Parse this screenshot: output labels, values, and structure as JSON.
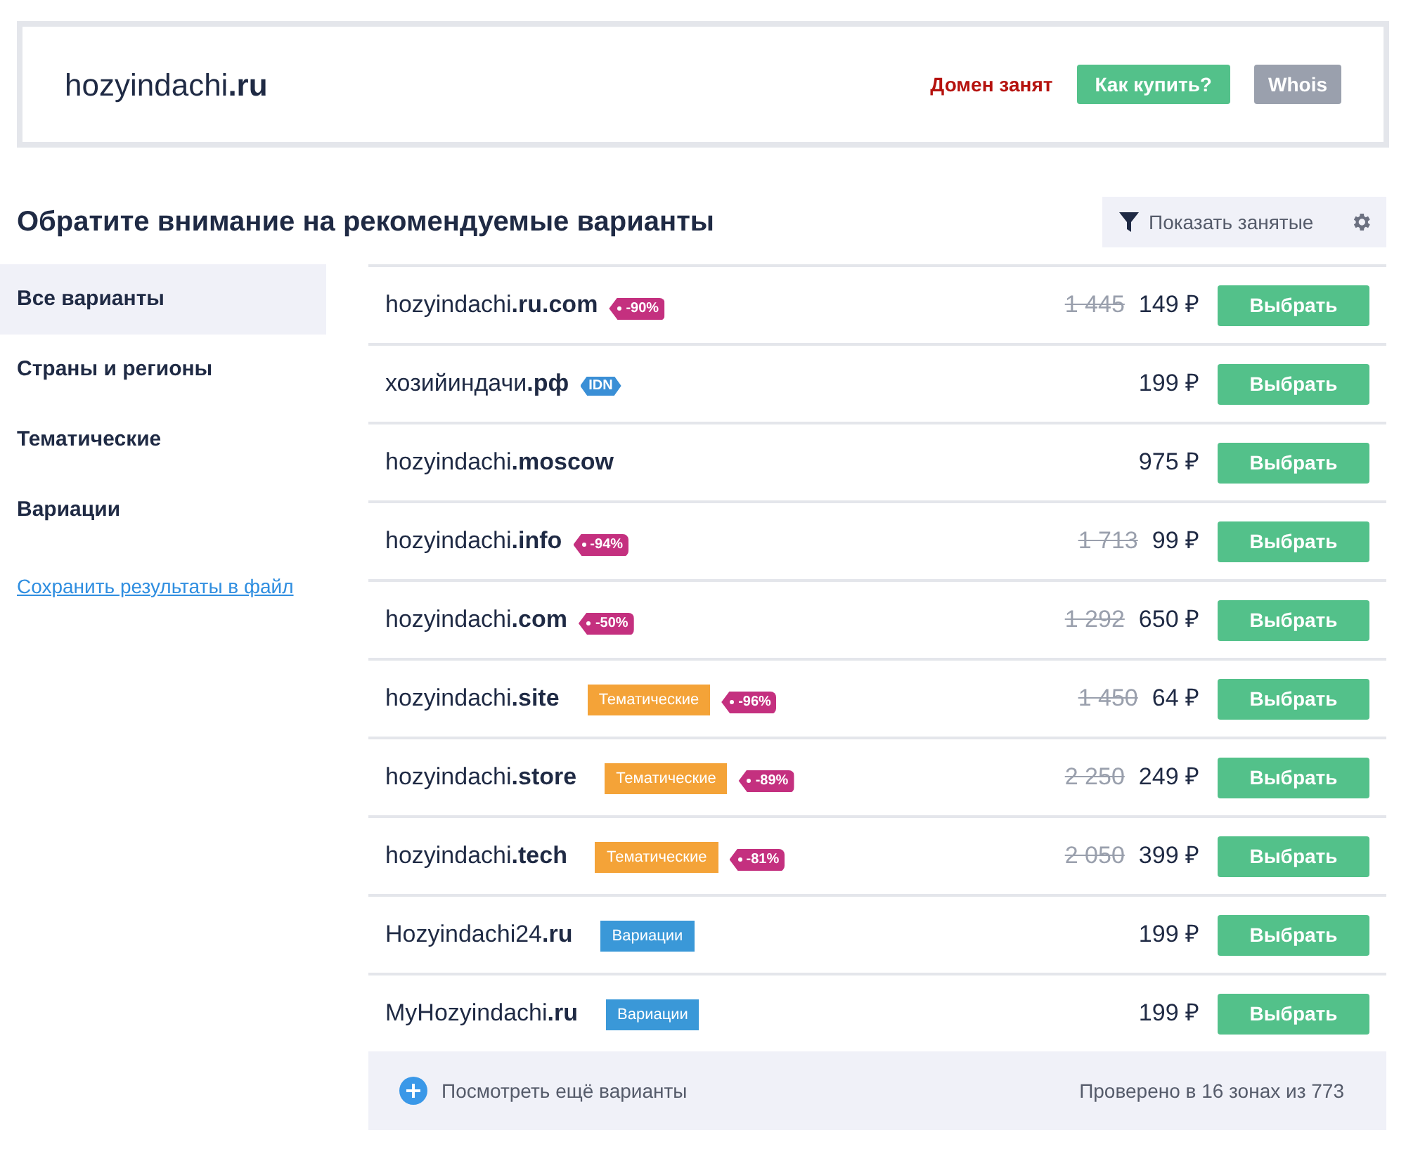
{
  "header": {
    "domain_name": "hozyindachi",
    "domain_zone": ".ru",
    "status": "Домен занят",
    "buy_button": "Как купить?",
    "whois_button": "Whois"
  },
  "heading": "Обратите внимание на рекомендуемые варианты",
  "filter_button": "Показать занятые",
  "sidebar": {
    "items": [
      {
        "label": "Все варианты",
        "selected": true
      },
      {
        "label": "Страны и регионы",
        "selected": false
      },
      {
        "label": "Тематические",
        "selected": false
      },
      {
        "label": "Вариации",
        "selected": false
      }
    ],
    "save_link": "Сохранить результаты в файл"
  },
  "rows": [
    {
      "name": "hozyindachi",
      "zone": ".ru.com",
      "tags": [
        {
          "kind": "discount",
          "text": "-90%"
        }
      ],
      "old_price": "1 445",
      "price": "149 ₽",
      "button": "Выбрать"
    },
    {
      "name": "хозийиндачи",
      "zone": ".рф",
      "tags": [
        {
          "kind": "idn",
          "text": "IDN"
        }
      ],
      "price": "199 ₽",
      "button": "Выбрать"
    },
    {
      "name": "hozyindachi",
      "zone": ".moscow",
      "tags": [],
      "price": "975 ₽",
      "button": "Выбрать"
    },
    {
      "name": "hozyindachi",
      "zone": ".info",
      "tags": [
        {
          "kind": "discount",
          "text": "-94%"
        }
      ],
      "old_price": "1 713",
      "price": "99 ₽",
      "button": "Выбрать"
    },
    {
      "name": "hozyindachi",
      "zone": ".com",
      "tags": [
        {
          "kind": "discount",
          "text": "-50%"
        }
      ],
      "old_price": "1 292",
      "price": "650 ₽",
      "button": "Выбрать"
    },
    {
      "name": "hozyindachi",
      "zone": ".site",
      "tags": [
        {
          "kind": "category",
          "text": "Тематические",
          "color": "#f4a338"
        },
        {
          "kind": "discount",
          "text": "-96%"
        }
      ],
      "old_price": "1 450",
      "price": "64 ₽",
      "button": "Выбрать"
    },
    {
      "name": "hozyindachi",
      "zone": ".store",
      "tags": [
        {
          "kind": "category",
          "text": "Тематические",
          "color": "#f4a338"
        },
        {
          "kind": "discount",
          "text": "-89%"
        }
      ],
      "old_price": "2 250",
      "price": "249 ₽",
      "button": "Выбрать"
    },
    {
      "name": "hozyindachi",
      "zone": ".tech",
      "tags": [
        {
          "kind": "category",
          "text": "Тематические",
          "color": "#f4a338"
        },
        {
          "kind": "discount",
          "text": "-81%"
        }
      ],
      "old_price": "2 050",
      "price": "399 ₽",
      "button": "Выбрать"
    },
    {
      "name": "Hozyindachi24",
      "zone": ".ru",
      "tags": [
        {
          "kind": "category",
          "text": "Вариации",
          "color": "#3a98d8"
        }
      ],
      "price": "199 ₽",
      "button": "Выбрать"
    },
    {
      "name": "MyHozyindachi",
      "zone": ".ru",
      "tags": [
        {
          "kind": "category",
          "text": "Вариации",
          "color": "#3a98d8"
        }
      ],
      "price": "199 ₽",
      "button": "Выбрать"
    }
  ],
  "footer": {
    "more_link": "Посмотреть ещё варианты",
    "checked_text": "Проверено в 16 зонах из 773"
  }
}
